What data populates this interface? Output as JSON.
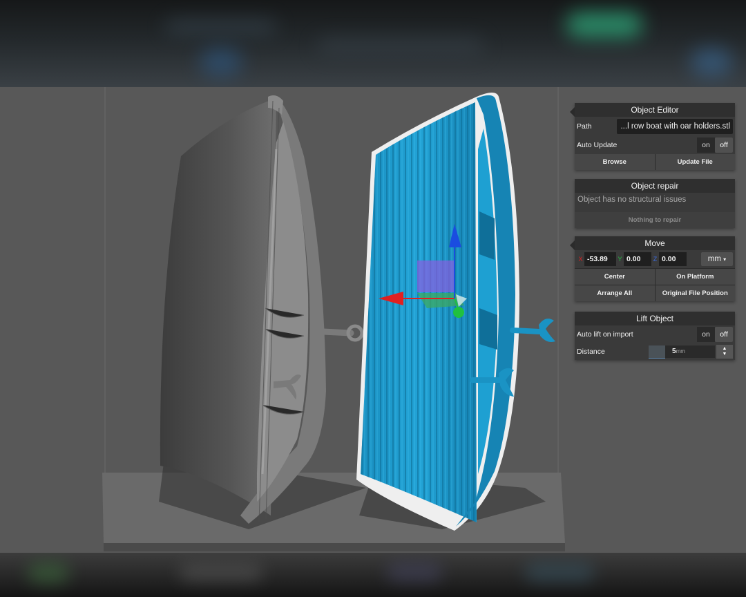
{
  "object_editor": {
    "title": "Object Editor",
    "path_label": "Path",
    "path_value": "...l row boat with oar holders.stl",
    "auto_update_label": "Auto Update",
    "on": "on",
    "off": "off",
    "browse": "Browse",
    "update_file": "Update File"
  },
  "object_repair": {
    "title": "Object repair",
    "message": "Object has no structural issues",
    "button": "Nothing to repair"
  },
  "move": {
    "title": "Move",
    "x_label": "X",
    "x_value": "-53.89",
    "y_label": "Y",
    "y_value": "0.00",
    "z_label": "Z",
    "z_value": "0.00",
    "unit": "mm",
    "center": "Center",
    "on_platform": "On Platform",
    "arrange_all": "Arrange All",
    "original_file_position": "Original File Position"
  },
  "lift_object": {
    "title": "Lift Object",
    "auto_lift_label": "Auto lift on import",
    "on": "on",
    "off": "off",
    "distance_label": "Distance",
    "distance_value": "5",
    "distance_unit": "mm"
  },
  "icons": {
    "dropdown": "chevron-down-icon",
    "stepper": "stepper-arrows-icon"
  },
  "colors": {
    "model_selected": "#1a93c4",
    "model_unselected": "#6b6b6b",
    "gizmo_x": "#e02020",
    "gizmo_y": "#20c040",
    "gizmo_z": "#1a4de0",
    "panel_bg": "#2b2b2b"
  }
}
